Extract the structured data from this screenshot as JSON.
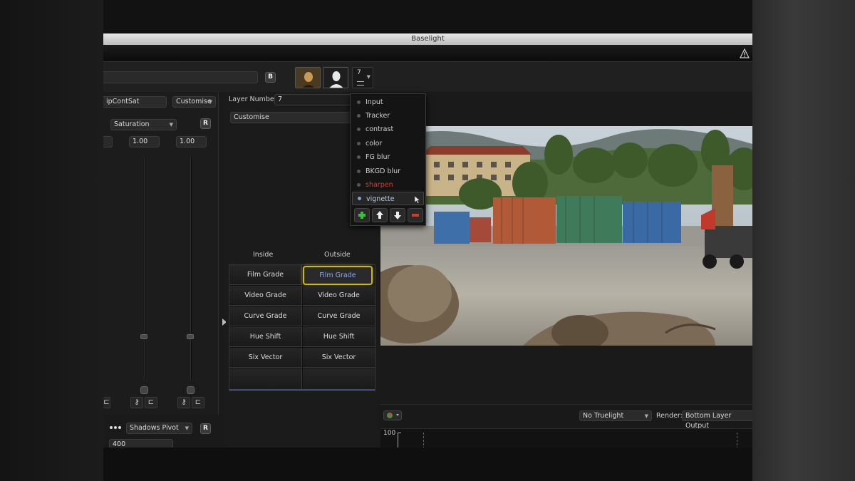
{
  "window": {
    "title": "Baselight"
  },
  "colors": {
    "accent_selected_border": "#c9b820",
    "selected_text": "#8fa8e8",
    "active_layer_red": "#d83a2a",
    "add_button": "#3cbf3c",
    "remove_button": "#d23a2a"
  },
  "toolbar": {
    "layer_count": "7",
    "small_button_letter": "B"
  },
  "left_panel": {
    "operator_name": "ipContSat",
    "mode_dropdown": "Customise",
    "parameter_dropdown": "Saturation",
    "reset_letter": "R",
    "value_fields": [
      "1.00",
      "1.00"
    ]
  },
  "left_bottom": {
    "pivot_dropdown": "Shadows Pivot",
    "reset_letter": "R",
    "value_field": "400"
  },
  "middle_panel": {
    "layer_number_label": "Layer Number:",
    "layer_number_value": "7",
    "customise_dropdown": "Customise",
    "col_inside": "Inside",
    "col_outside": "Outside",
    "inside": [
      "Film Grade",
      "Video Grade",
      "Curve Grade",
      "Hue Shift",
      "Six Vector"
    ],
    "outside": [
      "Film Grade",
      "Video Grade",
      "Curve Grade",
      "Hue Shift",
      "Six Vector"
    ]
  },
  "layers_popup": {
    "items": [
      "Input",
      "Tracker",
      "contrast",
      "color",
      "FG blur",
      "BKGD blur",
      "sharpen",
      "vignette"
    ],
    "active_index": 6,
    "selected_index": 7
  },
  "bottom_bar": {
    "truelight_dropdown": "No Truelight",
    "render_label": "Render:",
    "render_dropdown": "Bottom Layer Output",
    "scope_axis_value": "100"
  }
}
